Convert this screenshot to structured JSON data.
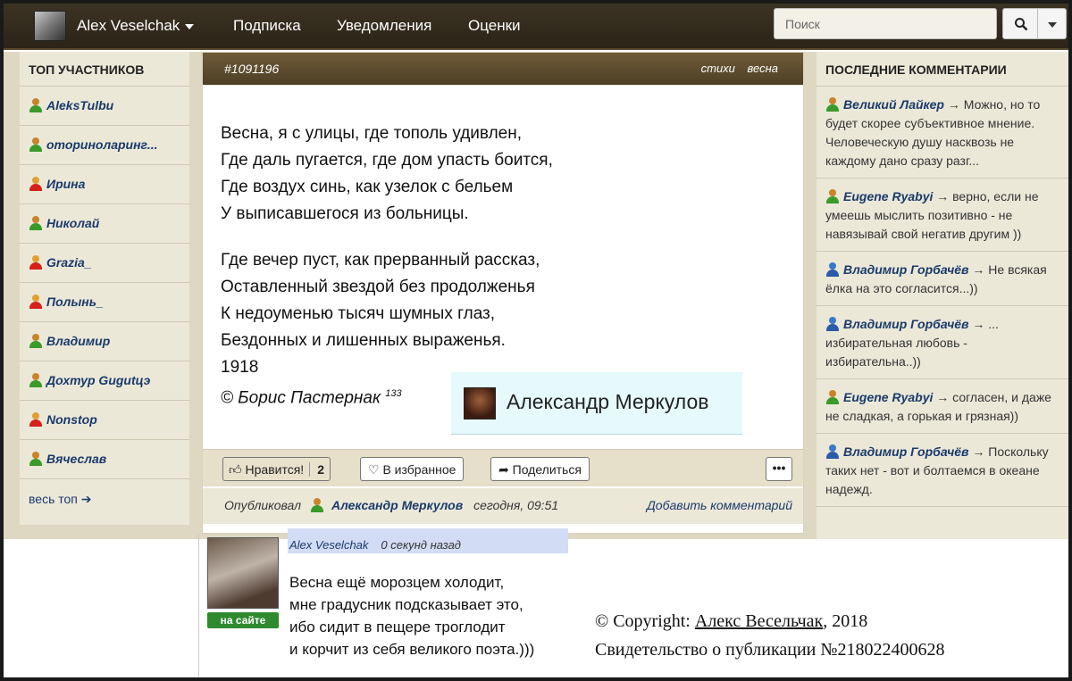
{
  "header": {
    "username": "Alex Veselchak",
    "nav": [
      "Подписка",
      "Уведомления",
      "Оценки"
    ],
    "search_placeholder": "Поиск"
  },
  "left_sidebar": {
    "title": "ТОП УЧАСТНИКОВ",
    "items": [
      {
        "name": "AleksTulbu",
        "icon": "user-green-icon"
      },
      {
        "name": "оториноларинг...",
        "icon": "user-green-icon"
      },
      {
        "name": "Ирина",
        "icon": "user-red-icon"
      },
      {
        "name": "Николай",
        "icon": "user-green-icon"
      },
      {
        "name": "Grazia_",
        "icon": "user-red-icon"
      },
      {
        "name": "Полынь_",
        "icon": "user-red-icon"
      },
      {
        "name": "Владимир",
        "icon": "user-green-icon"
      },
      {
        "name": "Дохтур Gugutцэ",
        "icon": "user-green-icon"
      },
      {
        "name": "Nonstop",
        "icon": "user-red-icon"
      },
      {
        "name": "Вячеслав",
        "icon": "user-green-icon"
      }
    ],
    "all_top": "весь топ"
  },
  "post": {
    "id": "#1091196",
    "tags": [
      "стихи",
      "весна"
    ],
    "stanzas": [
      [
        "Весна, я с улицы, где тополь удивлен,",
        "Где даль пугается, где дом упасть боится,",
        "Где воздух синь, как узелок с бельем",
        "У выписавшегося из больницы."
      ],
      [
        "Где вечер пуст, как прерванный рассказ,",
        "Оставленный звездой без продолженья",
        "К недоуменью тысяч шумных глаз,",
        "Бездонных и лишенных выраженья.",
        "1918"
      ]
    ],
    "signature": "© Борис Пастернак",
    "signature_sup": "133",
    "author_popup": "Александр Меркулов",
    "like_label": "Нравится!",
    "like_count": "2",
    "favorite_label": "В избранное",
    "share_label": "Поделиться",
    "more_label": "•••",
    "published_label": "Опубликовал",
    "published_author": "Александр Меркулов",
    "published_time": "сегодня, 09:51",
    "add_comment": "Добавить комментарий"
  },
  "right_sidebar": {
    "title": "ПОСЛЕДНИЕ КОММЕНТАРИИ",
    "comments": [
      {
        "author": "Великий Лайкер",
        "icon": "user-green-icon",
        "text": "Можно, но то будет скорее субъективное мнение. Человеческую душу насквозь не каждому дано сразу разг..."
      },
      {
        "author": "Eugene Ryabyi",
        "icon": "user-green-icon",
        "text": "верно, если не умеешь мыслить позитивно - не навязывай свой негатив другим ))"
      },
      {
        "author": "Владимир Горбачёв",
        "icon": "user-blue-icon",
        "text": "Не всякая ёлка на это согласится...))"
      },
      {
        "author": "Владимир Горбачёв",
        "icon": "user-blue-icon",
        "text": "... избирательная любовь - избирательна..))"
      },
      {
        "author": "Eugene Ryabyi",
        "icon": "user-green-icon",
        "text": "согласен, и даже не сладкая, а горькая и грязная))"
      },
      {
        "author": "Владимир Горбачёв",
        "icon": "user-blue-icon",
        "text": "Поскольку таких нет - вот и болтаемся в океане надежд."
      }
    ]
  },
  "reply": {
    "author": "Alex Veselchak",
    "time": "0 секунд назад",
    "online": "на сайте",
    "lines": [
      "Весна ещё морозцем холодит,",
      "мне градусник подсказывает это,",
      "ибо сидит в пещере троглодит",
      "и корчит из себя великого поэта.)))"
    ]
  },
  "copyright": {
    "prefix": "© Copyright: ",
    "author": "Алекс Весельчак",
    "year": ", 2018",
    "certificate": "Свидетельство о публикации №218022400628"
  }
}
